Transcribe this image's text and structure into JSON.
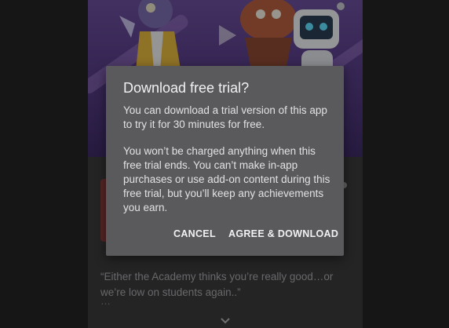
{
  "dialog": {
    "title": "Download free trial?",
    "paragraph_1": "You can download a trial version of this app to try it for 30 minutes for free.",
    "paragraph_2": "You won’t be charged anything when this free trial ends. You can’t make in-app purchases or use add-on content during this free trial, but you’ll keep any achievements you earn.",
    "cancel_label": "CANCEL",
    "agree_label": "AGREE & DOWNLOAD"
  },
  "app_page": {
    "description": "“Either the Academy thinks you’re really good…or we’re low on students again..”",
    "more_indicator": "…"
  },
  "icons": {
    "play": "play-icon",
    "expand": "chevron-down-icon"
  },
  "colors": {
    "dialog_bg": "#5a5a5c",
    "banner_purple": "#5a3f8a"
  }
}
